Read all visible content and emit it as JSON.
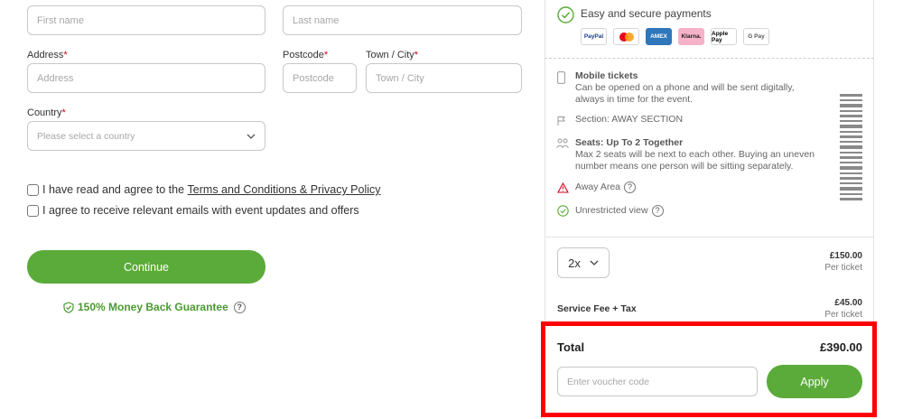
{
  "form": {
    "first_name_placeholder": "First name",
    "last_name_placeholder": "Last name",
    "address_label": "Address",
    "address_placeholder": "Address",
    "postcode_label": "Postcode",
    "postcode_placeholder": "Postcode",
    "town_label": "Town / City",
    "town_placeholder": "Town / City",
    "required_mark": "*",
    "country_label": "Country",
    "country_placeholder": "Please select a country",
    "terms_prefix": "I have read and agree to the ",
    "terms_link": "Terms and Conditions & Privacy Policy",
    "emails_label": "I agree to receive relevant emails with event updates and offers",
    "continue_label": "Continue",
    "guarantee_label": "150% Money Back Guarantee"
  },
  "summary": {
    "secure_label": "Easy and secure payments",
    "payment_methods": [
      "PayPal",
      "Mastercard",
      "AMEX",
      "Klarna.",
      "Apple Pay",
      "G Pay"
    ],
    "mobile_title": "Mobile tickets",
    "mobile_text_1": "Can be opened on a phone and will be sent digitally,",
    "mobile_text_2": "always in time for the event.",
    "section_text": "Section: AWAY SECTION",
    "seats_title": "Seats: Up To 2 Together",
    "seats_text_1": "Max 2 seats will be next to each other. Buying an uneven",
    "seats_text_2": "number means one person will be sitting separately.",
    "away_area": "Away Area",
    "unrestricted": "Unrestricted view",
    "quantity": "2x",
    "ticket_price": "£150.00",
    "per_ticket": "Per ticket",
    "service_fee_label": "Service Fee + Tax",
    "service_fee_price": "£45.00",
    "service_fee_per": "Per ticket",
    "total_label": "Total",
    "total_value": "£390.00",
    "voucher_placeholder": "Enter voucher code",
    "apply_label": "Apply"
  },
  "colors": {
    "accent": "#5bab3a",
    "highlight": "#ff0000"
  }
}
